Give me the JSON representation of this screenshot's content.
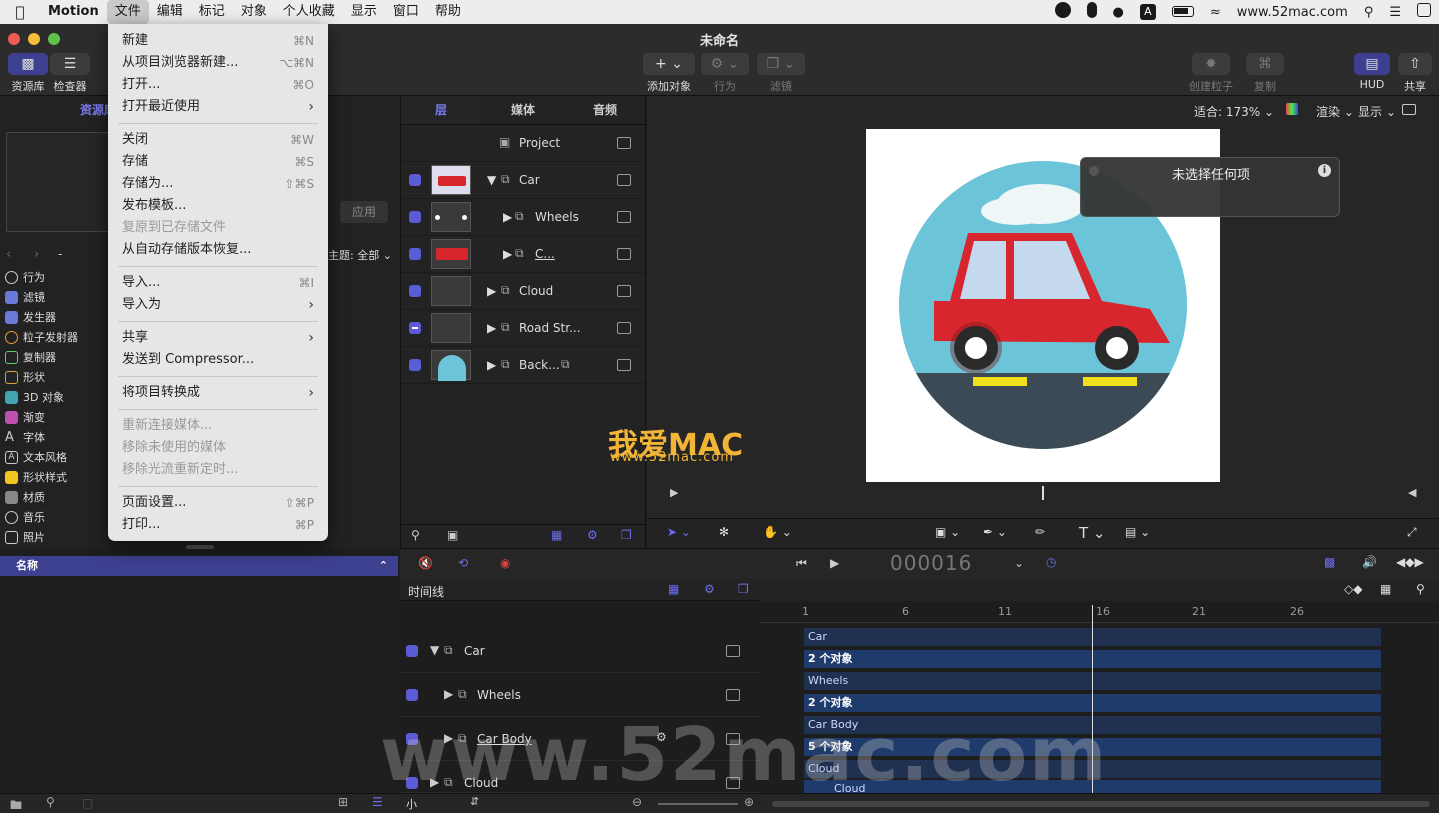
{
  "menubar": {
    "app_name": "Motion",
    "items": [
      "文件",
      "编辑",
      "标记",
      "对象",
      "个人收藏",
      "显示",
      "窗口",
      "帮助"
    ],
    "status_text": "www.52mac.com"
  },
  "window": {
    "title": "未命名",
    "toolbar_left": [
      "资源库",
      "检查器"
    ],
    "add_object": "添加对象",
    "behaviors": "行为",
    "filters": "滤镜",
    "create_particles": "创建粒子",
    "replicate": "复制",
    "hud": "HUD",
    "share": "共享"
  },
  "file_menu": {
    "items": [
      {
        "label": "新建",
        "shortcut": "⌘N",
        "enabled": true
      },
      {
        "label": "从项目浏览器新建...",
        "shortcut": "⌥⌘N",
        "enabled": true
      },
      {
        "label": "打开...",
        "shortcut": "⌘O",
        "enabled": true
      },
      {
        "label": "打开最近使用",
        "shortcut": "›",
        "enabled": true
      },
      {
        "label": "关闭",
        "shortcut": "⌘W",
        "enabled": true
      },
      {
        "label": "存储",
        "shortcut": "⌘S",
        "enabled": true
      },
      {
        "label": "存储为...",
        "shortcut": "⇧⌘S",
        "enabled": true
      },
      {
        "label": "发布模板...",
        "shortcut": "",
        "enabled": true
      },
      {
        "label": "复原到已存储文件",
        "shortcut": "",
        "enabled": false
      },
      {
        "label": "从自动存储版本恢复...",
        "shortcut": "",
        "enabled": true
      },
      {
        "label": "导入...",
        "shortcut": "⌘I",
        "enabled": true
      },
      {
        "label": "导入为",
        "shortcut": "›",
        "enabled": true
      },
      {
        "label": "共享",
        "shortcut": "›",
        "enabled": true
      },
      {
        "label": "发送到 Compressor...",
        "shortcut": "",
        "enabled": true
      },
      {
        "label": "将项目转换成",
        "shortcut": "›",
        "enabled": true
      },
      {
        "label": "重新连接媒体...",
        "shortcut": "",
        "enabled": false
      },
      {
        "label": "移除未使用的媒体",
        "shortcut": "",
        "enabled": false
      },
      {
        "label": "移除光流重新定时...",
        "shortcut": "",
        "enabled": false
      },
      {
        "label": "页面设置...",
        "shortcut": "⇧⌘P",
        "enabled": true
      },
      {
        "label": "打印...",
        "shortcut": "⌘P",
        "enabled": true
      }
    ]
  },
  "library": {
    "tab": "资源库",
    "apply_button": "应用",
    "theme_label": "主题: 全部",
    "nav_dash": "-",
    "categories": [
      "行为",
      "滤镜",
      "发生器",
      "粒子发射器",
      "复制器",
      "形状",
      "3D 对象",
      "渐变",
      "字体",
      "文本风格",
      "形状样式",
      "材质",
      "音乐",
      "照片"
    ],
    "name_header": "名称"
  },
  "layers_panel": {
    "tabs": [
      "层",
      "媒体",
      "音频"
    ],
    "project_label": "Project",
    "layers": [
      "Car",
      "Wheels",
      "C...",
      "Cloud",
      "Road Str...",
      "Back..."
    ]
  },
  "canvas": {
    "fit_label": "适合:",
    "zoom": "173%",
    "render": "渲染",
    "view": "显示",
    "hud_title": "未选择任何项",
    "brand_text": "我爱MAC",
    "brand_url": "www.52mac.com"
  },
  "timeline": {
    "timecode": "000016",
    "header": "时间线",
    "ruler": [
      "1",
      "6",
      "11",
      "16",
      "21",
      "26"
    ],
    "rows": [
      "Car",
      "Wheels",
      "Car Body",
      "Cloud"
    ],
    "bars": [
      "Car",
      "2 个对象",
      "Wheels",
      "2 个对象",
      "Car Body",
      "5 个对象",
      "Cloud",
      "Cloud"
    ],
    "size_label": "小"
  },
  "watermark": "www.52mac.com",
  "colors": {
    "accent": "#5b5bd6",
    "timeline_bar": "#1f3b6b",
    "menu_bg": "#e6e6e6"
  }
}
